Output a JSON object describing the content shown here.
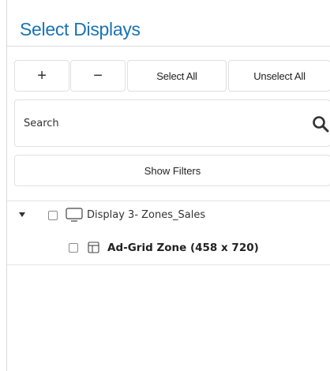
{
  "header": {
    "title": "Select Displays"
  },
  "toolbar": {
    "add_label": "+",
    "remove_label": "−",
    "select_all_label": "Select All",
    "unselect_all_label": "Unselect All"
  },
  "search": {
    "label": "Search",
    "icon": "search-icon"
  },
  "filters": {
    "label": "Show Filters"
  },
  "tree": {
    "items": [
      {
        "label": "Display 3- Zones_Sales",
        "icon": "monitor-icon",
        "expanded": true,
        "checked": false
      },
      {
        "label": "Ad-Grid Zone (458 x 720)",
        "icon": "zone-layout-icon",
        "checked": false
      }
    ]
  },
  "colors": {
    "title": "#1a73b5",
    "border": "#e0e0e0"
  }
}
